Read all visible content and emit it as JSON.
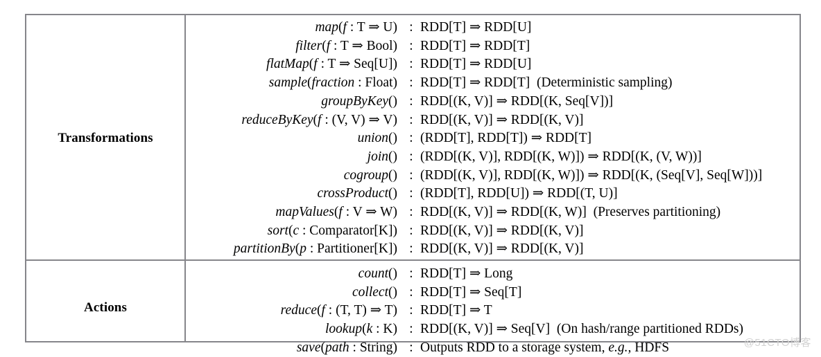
{
  "table": {
    "sections": [
      {
        "label": "Transformations",
        "rows": [
          {
            "name": "map",
            "signature": "map(f : T ⇒ U)",
            "colon": ":",
            "type": "RDD[T] ⇒ RDD[U]",
            "note": ""
          },
          {
            "name": "filter",
            "signature": "filter(f : T ⇒ Bool)",
            "colon": ":",
            "type": "RDD[T] ⇒ RDD[T]",
            "note": ""
          },
          {
            "name": "flatMap",
            "signature": "flatMap(f : T ⇒ Seq[U])",
            "colon": ":",
            "type": "RDD[T] ⇒ RDD[U]",
            "note": ""
          },
          {
            "name": "sample",
            "signature": "sample(fraction : Float)",
            "colon": ":",
            "type": "RDD[T] ⇒ RDD[T]",
            "note": "(Deterministic sampling)"
          },
          {
            "name": "groupByKey",
            "signature": "groupByKey()",
            "colon": ":",
            "type": "RDD[(K, V)] ⇒ RDD[(K, Seq[V])]",
            "note": ""
          },
          {
            "name": "reduceByKey",
            "signature": "reduceByKey(f : (V, V) ⇒ V)",
            "colon": ":",
            "type": "RDD[(K, V)] ⇒ RDD[(K, V)]",
            "note": ""
          },
          {
            "name": "union",
            "signature": "union()",
            "colon": ":",
            "type": "(RDD[T], RDD[T]) ⇒ RDD[T]",
            "note": ""
          },
          {
            "name": "join",
            "signature": "join()",
            "colon": ":",
            "type": "(RDD[(K, V)], RDD[(K, W)]) ⇒ RDD[(K, (V, W))]",
            "note": ""
          },
          {
            "name": "cogroup",
            "signature": "cogroup()",
            "colon": ":",
            "type": "(RDD[(K, V)], RDD[(K, W)]) ⇒ RDD[(K, (Seq[V], Seq[W]))]",
            "note": ""
          },
          {
            "name": "crossProduct",
            "signature": "crossProduct()",
            "colon": ":",
            "type": "(RDD[T], RDD[U]) ⇒ RDD[(T, U)]",
            "note": ""
          },
          {
            "name": "mapValues",
            "signature": "mapValues(f : V ⇒ W)",
            "colon": ":",
            "type": "RDD[(K, V)] ⇒ RDD[(K, W)]",
            "note": "(Preserves partitioning)"
          },
          {
            "name": "sort",
            "signature": "sort(c : Comparator[K])",
            "colon": ":",
            "type": "RDD[(K, V)] ⇒ RDD[(K, V)]",
            "note": ""
          },
          {
            "name": "partitionBy",
            "signature": "partitionBy(p : Partitioner[K])",
            "colon": ":",
            "type": "RDD[(K, V)] ⇒ RDD[(K, V)]",
            "note": ""
          }
        ]
      },
      {
        "label": "Actions",
        "rows": [
          {
            "name": "count",
            "signature": "count()",
            "colon": ":",
            "type": "RDD[T] ⇒ Long",
            "note": ""
          },
          {
            "name": "collect",
            "signature": "collect()",
            "colon": ":",
            "type": "RDD[T] ⇒ Seq[T]",
            "note": ""
          },
          {
            "name": "reduce",
            "signature": "reduce(f : (T, T) ⇒ T)",
            "colon": ":",
            "type": "RDD[T] ⇒ T",
            "note": ""
          },
          {
            "name": "lookup",
            "signature": "lookup(k : K)",
            "colon": ":",
            "type": "RDD[(K, V)] ⇒ Seq[V]",
            "note": "(On hash/range partitioned RDDs)"
          },
          {
            "name": "save",
            "signature": "save(path : String)",
            "colon": ":",
            "type": "Outputs RDD to a storage system, e.g., HDFS",
            "note": ""
          }
        ]
      }
    ]
  },
  "watermark": "@51CTO博客",
  "colors": {
    "border": "#85858a",
    "text": "#000000",
    "watermark": "#d2d2d2",
    "background": "#ffffff"
  }
}
